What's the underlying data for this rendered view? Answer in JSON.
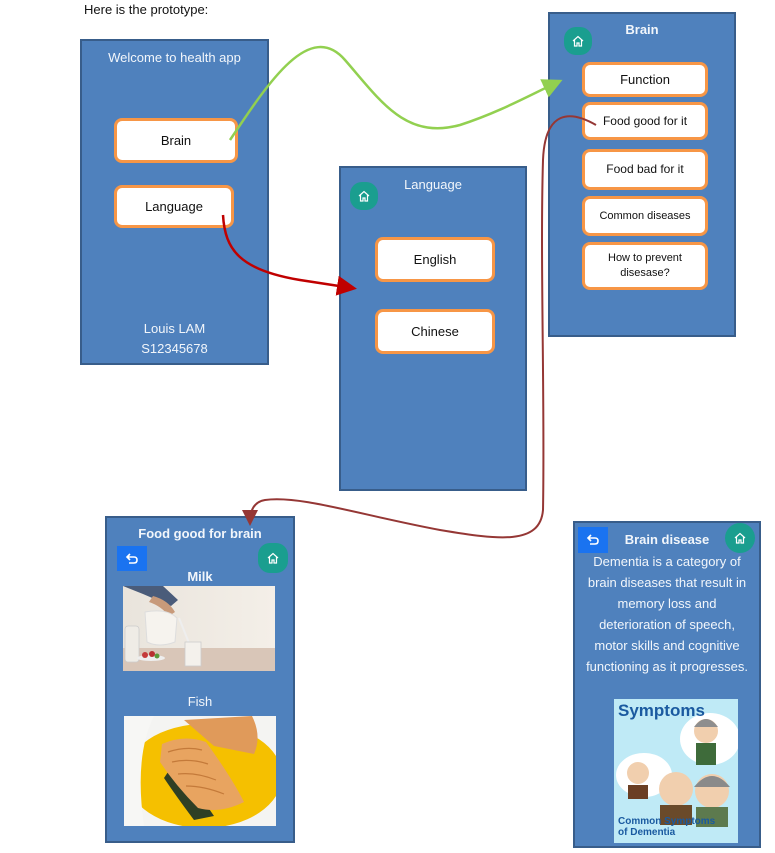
{
  "caption": "Here is the prototype:",
  "colors": {
    "screen_bg": "#4f81bd",
    "screen_border": "#385d8a",
    "button_border": "#f79646",
    "home_button": "#1a9e8f",
    "back_button": "#1a73f0",
    "arrow_green": "#92d050",
    "arrow_red": "#c00000",
    "arrow_darkred": "#953735"
  },
  "screens": {
    "welcome": {
      "title": "Welcome to health app",
      "buttons": [
        "Brain",
        "Language"
      ],
      "footer": [
        "Louis LAM",
        "S12345678"
      ]
    },
    "language": {
      "title": "Language",
      "home_icon": "home-icon",
      "buttons": [
        "English",
        "Chinese"
      ]
    },
    "brain": {
      "title": "Brain",
      "home_icon": "home-icon",
      "buttons": [
        "Function",
        "Food good for it",
        "Food bad for it",
        "Common diseases",
        "How to prevent disesase?"
      ]
    },
    "food_good": {
      "title": "Food good for brain",
      "back_icon": "back-arrow-icon",
      "home_icon": "home-icon",
      "items": [
        {
          "label": "Milk",
          "image": "milk-pouring-photo"
        },
        {
          "label": "Fish",
          "image": "salmon-fillet-photo"
        }
      ]
    },
    "brain_disease": {
      "title": "Brain disease",
      "back_icon": "back-arrow-icon",
      "home_icon": "home-icon",
      "body": "Dementia is a category of brain diseases that result in memory loss and deterioration of speech, motor skills and cognitive functioning as it progresses.",
      "image": {
        "heading": "Symptoms",
        "caption_line1": "Common Symptoms",
        "caption_line2": "of Dementia"
      }
    }
  },
  "flows": [
    {
      "from": "Brain",
      "to": "Brain screen",
      "color": "green"
    },
    {
      "from": "Language",
      "to": "Language screen",
      "color": "red"
    },
    {
      "from": "Food good for it",
      "to": "Food good for brain screen",
      "color": "darkred"
    }
  ]
}
